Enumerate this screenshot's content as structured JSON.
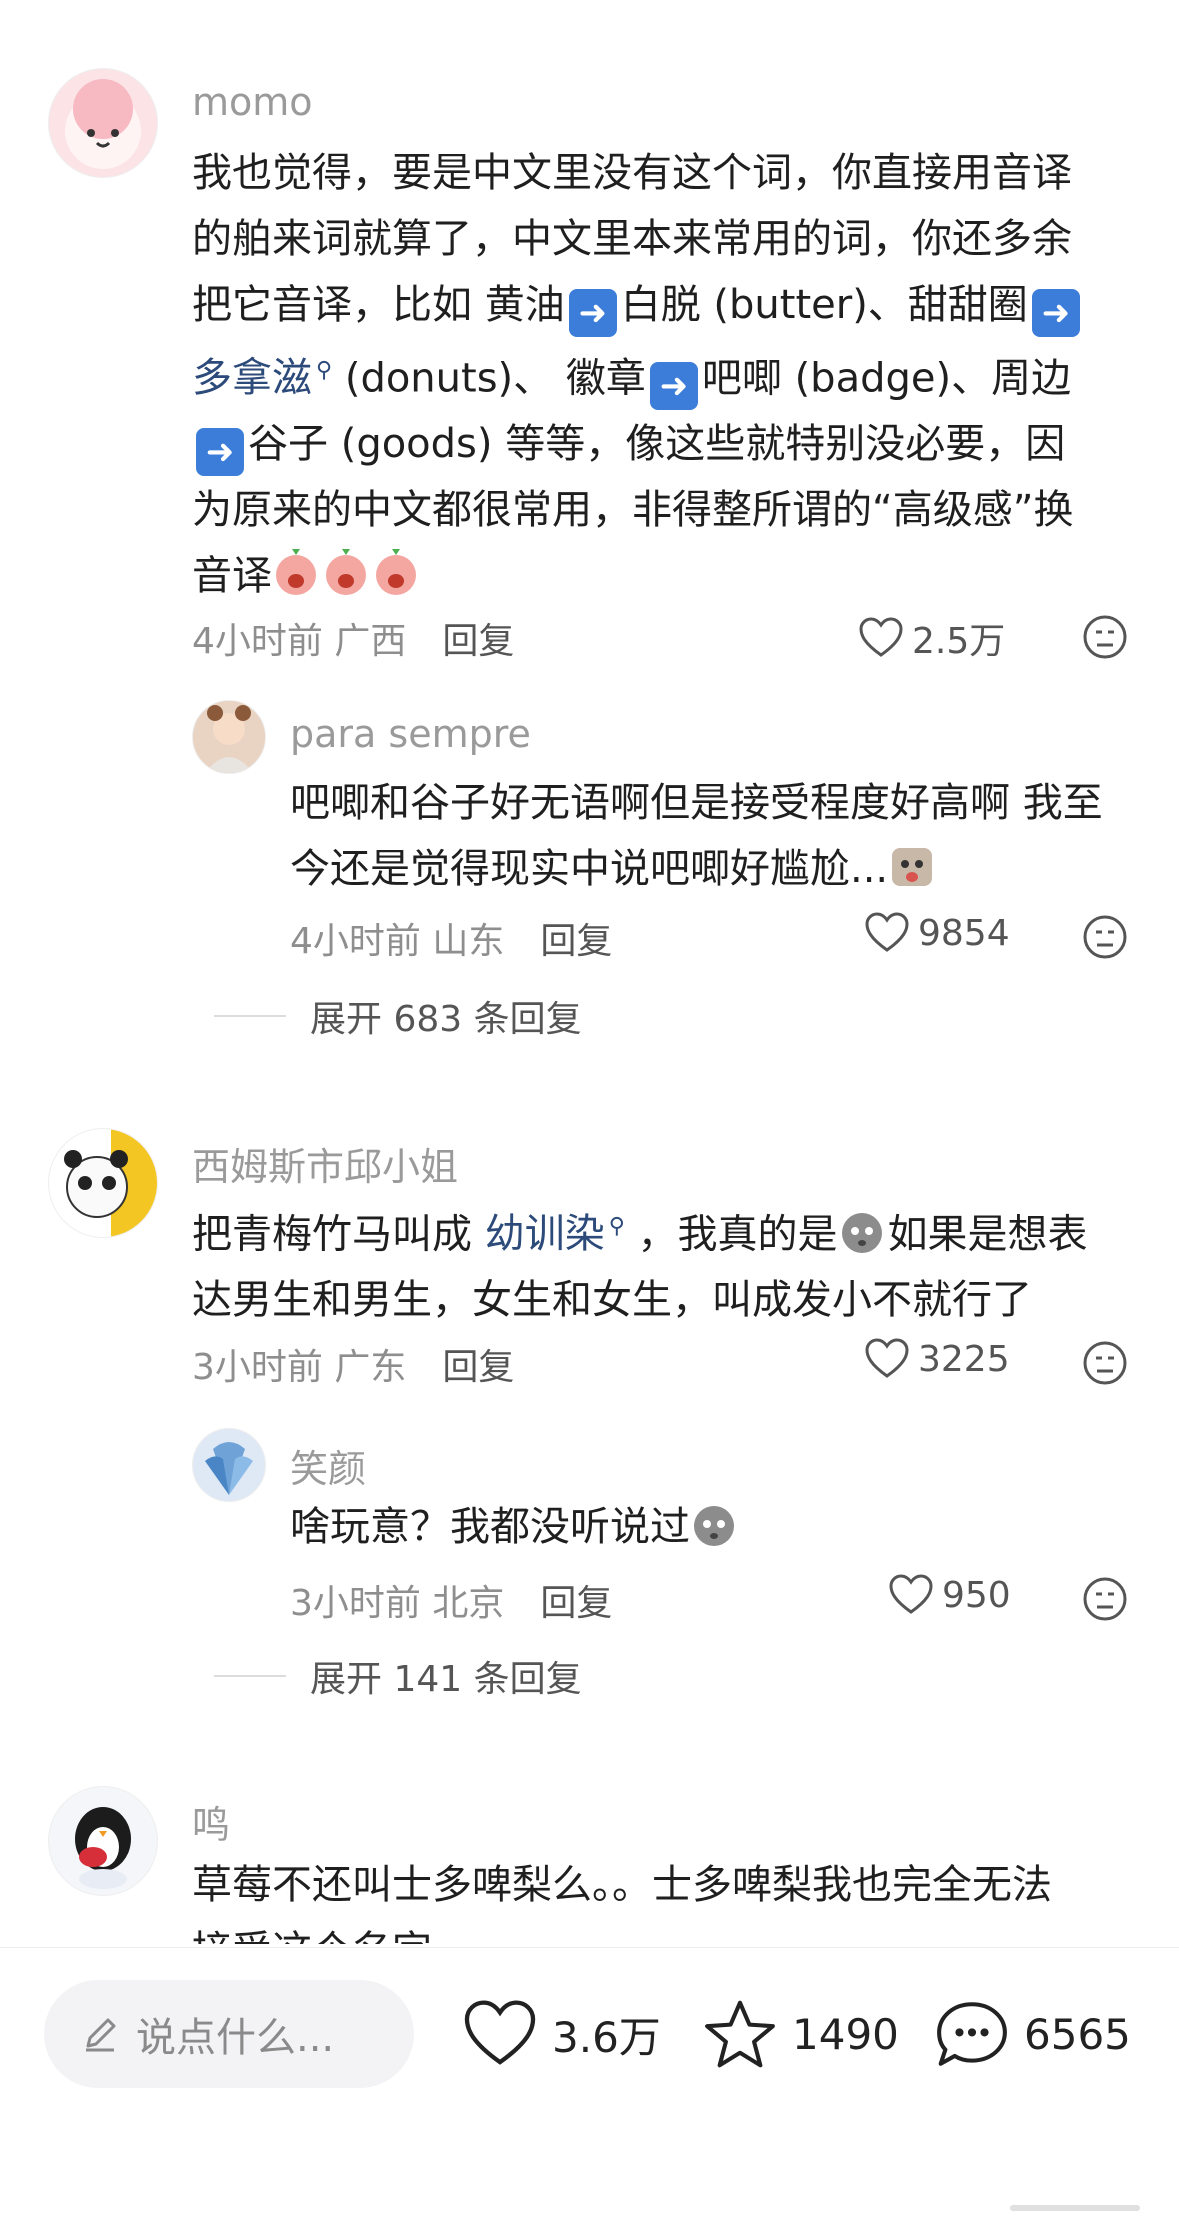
{
  "comments": [
    {
      "user": "momo",
      "lines": [
        "我也觉得，要是中文里没有这个词，你直接用音译",
        "的舶来词就算了，中文里本来常用的词，你还多余",
        "把它音译，比如  黄油",
        "白脱 (butter)、甜甜圈",
        "多拿滋",
        " (donuts)、 徽章",
        "吧唧 (badge)、周边",
        "谷子 (goods) 等等，像这些就特别没必要，因",
        "为原来的中文都很常用，非得整所谓的“高级感”换",
        "音译"
      ],
      "time": "4小时前",
      "location": "广西",
      "reply_label": "回复",
      "likes": "2.5万"
    },
    {
      "user": "para sempre",
      "lines": [
        "吧唧和谷子好无语啊但是接受程度好高啊 我至",
        "今还是觉得现实中说吧唧好尴尬..."
      ],
      "time": "4小时前",
      "location": "山东",
      "reply_label": "回复",
      "likes": "9854"
    },
    {
      "user": "西姆斯市邱小姐",
      "lines": [
        "把青梅竹马叫成 ",
        "幼训染",
        " ，我真的是",
        "如果是想表",
        "达男生和男生，女生和女生，叫成发小不就行了"
      ],
      "time": "3小时前",
      "location": "广东",
      "reply_label": "回复",
      "likes": "3225"
    },
    {
      "user": "笑颜",
      "lines": [
        "啥玩意？我都没听说过"
      ],
      "time": "3小时前",
      "location": "北京",
      "reply_label": "回复",
      "likes": "950"
    },
    {
      "user": "鸣",
      "lines": [
        "草莓不还叫士多啤梨么。。士多啤梨我也完全无法",
        "接受这个名字"
      ]
    }
  ],
  "expand": [
    "展开 683 条回复",
    "展开 141 条回复"
  ],
  "bottom": {
    "input_placeholder": "说点什么...",
    "likes": "3.6万",
    "favorites": "1490",
    "comments": "6565"
  }
}
